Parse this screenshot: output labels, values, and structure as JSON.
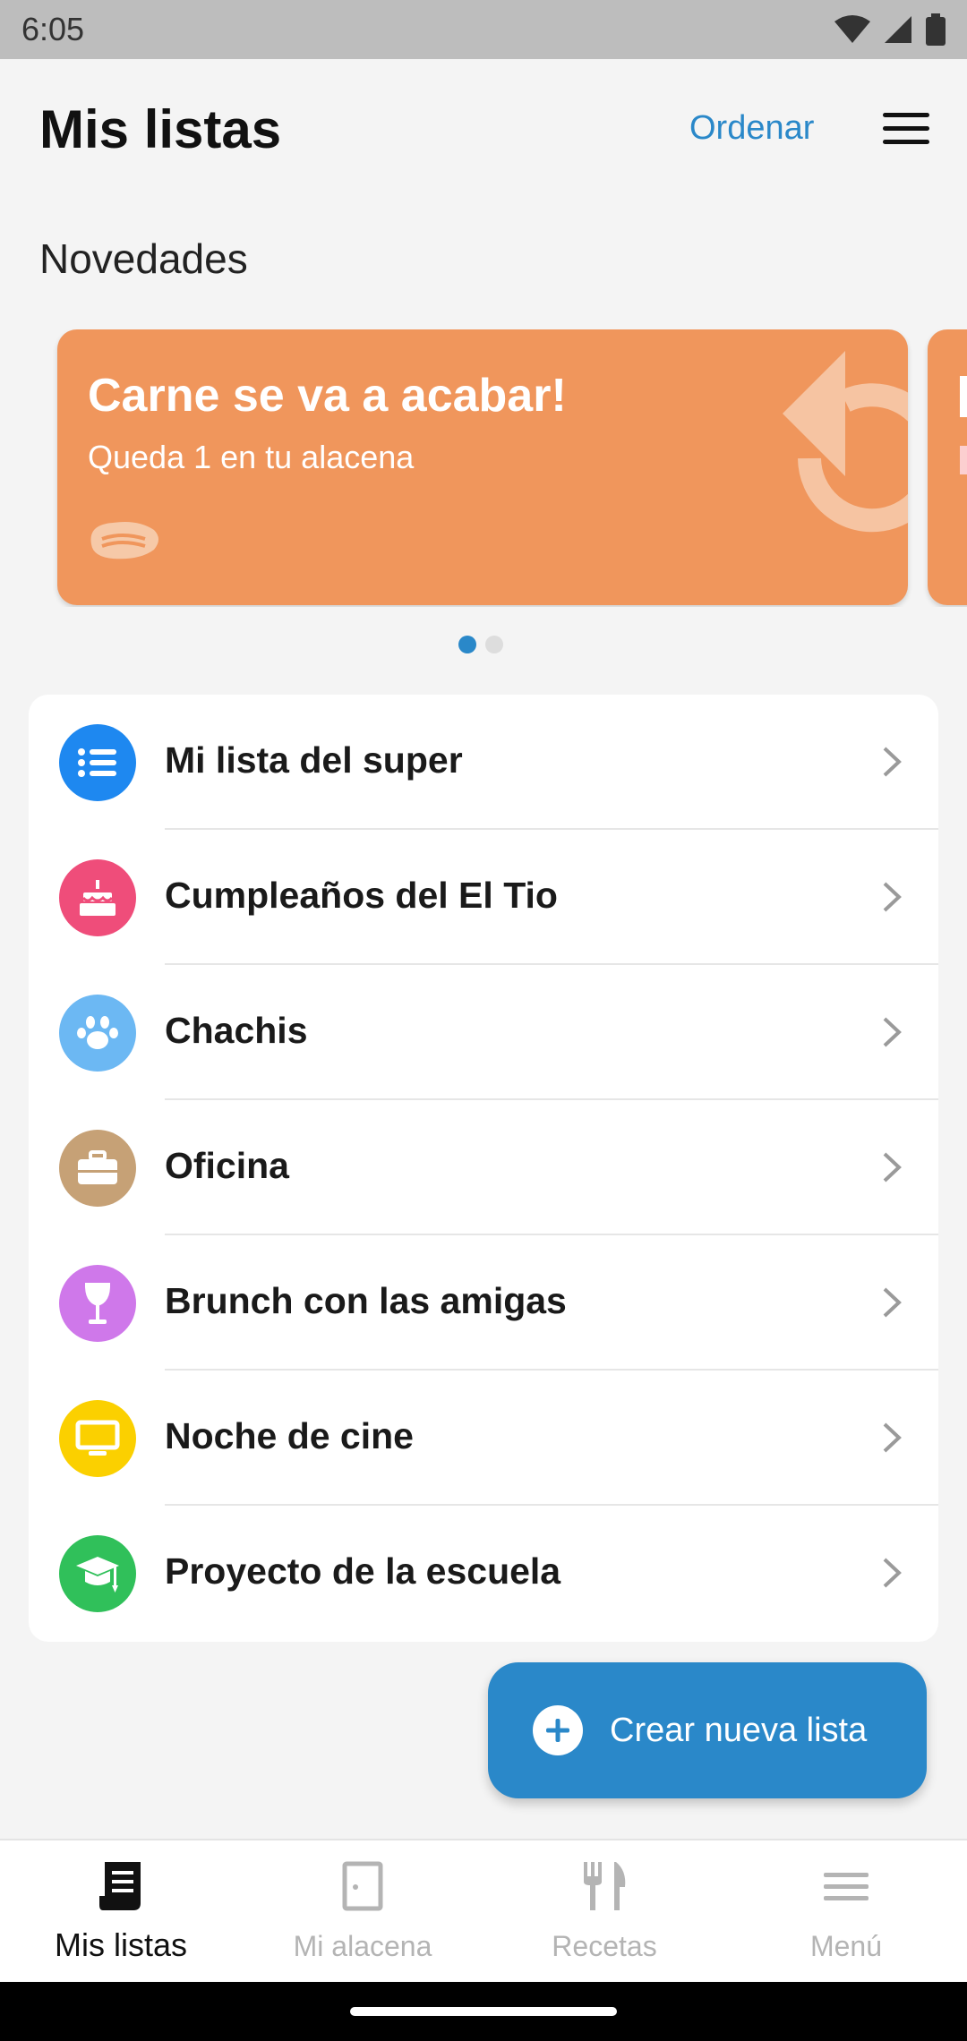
{
  "status": {
    "time": "6:05"
  },
  "header": {
    "title": "Mis listas",
    "sort_label": "Ordenar"
  },
  "news": {
    "section_title": "Novedades",
    "cards": [
      {
        "title": "Carne se va a acabar!",
        "subtitle": "Queda 1 en tu alacena",
        "color": "#f0965c",
        "icon": "steak-icon"
      }
    ],
    "page_count": 2,
    "active_page": 1
  },
  "lists": [
    {
      "label": "Mi lista del super",
      "icon": "list-icon",
      "color": "#1e88f0"
    },
    {
      "label": "Cumpleaños del El Tio",
      "icon": "cake-icon",
      "color": "#ef4d7a"
    },
    {
      "label": "Chachis",
      "icon": "paw-icon",
      "color": "#6cb8f3"
    },
    {
      "label": "Oficina",
      "icon": "briefcase-icon",
      "color": "#c6a176"
    },
    {
      "label": "Brunch con las amigas",
      "icon": "wine-glass-icon",
      "color": "#cf78ea"
    },
    {
      "label": "Noche de cine",
      "icon": "tv-icon",
      "color": "#fbd000"
    },
    {
      "label": "Proyecto de la escuela",
      "icon": "graduation-cap-icon",
      "color": "#30c05a"
    }
  ],
  "fab": {
    "label": "Crear nueva lista"
  },
  "bottom_nav": [
    {
      "label": "Mis listas",
      "icon": "receipt-list-icon",
      "active": true
    },
    {
      "label": "Mi alacena",
      "icon": "pantry-door-icon",
      "active": false
    },
    {
      "label": "Recetas",
      "icon": "fork-knife-icon",
      "active": false
    },
    {
      "label": "Menú",
      "icon": "menu-lines-icon",
      "active": false
    }
  ]
}
